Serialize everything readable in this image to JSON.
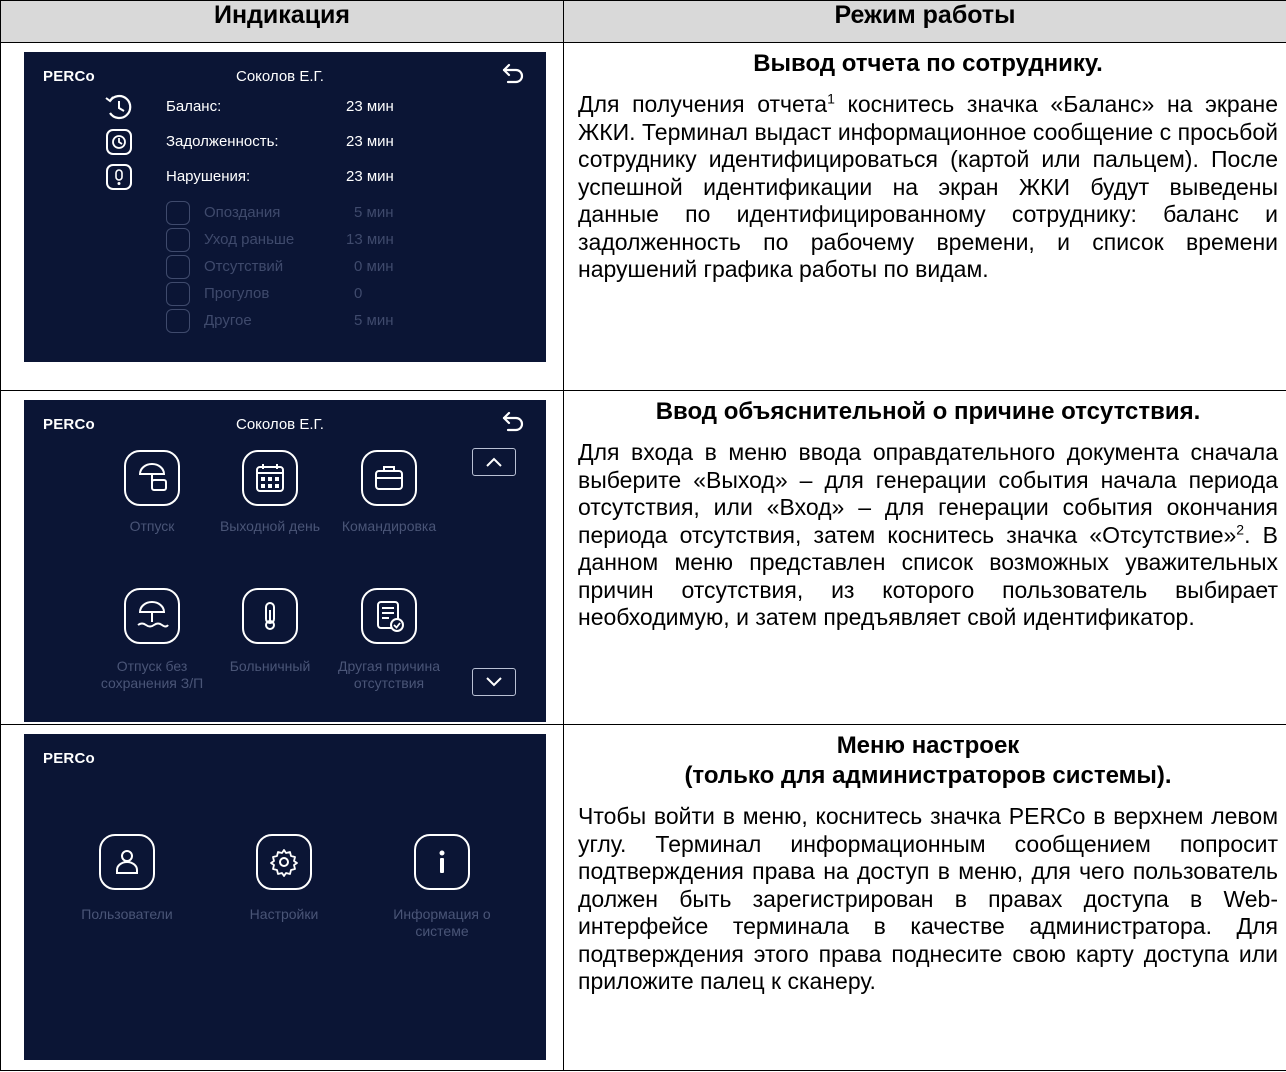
{
  "header": {
    "col1": "Индикация",
    "col2": "Режим работы"
  },
  "screen1": {
    "brand": "PERCo",
    "user": "Соколов Е.Г.",
    "main_rows": [
      {
        "label": "Баланс:",
        "value": "23 мин"
      },
      {
        "label": "Задолженность:",
        "value": "23 мин"
      },
      {
        "label": "Нарушения:",
        "value": "23 мин"
      }
    ],
    "sub_rows": [
      {
        "label": "Опоздания",
        "value": "5 мин"
      },
      {
        "label": "Уход раньше",
        "value": "13 мин"
      },
      {
        "label": "Отсутствий",
        "value": "0 мин"
      },
      {
        "label": "Прогулов",
        "value": "0"
      },
      {
        "label": "Другое",
        "value": "5 мин"
      }
    ]
  },
  "screen2": {
    "brand": "PERCo",
    "user": "Соколов Е.Г.",
    "tiles": [
      {
        "label": "Отпуск"
      },
      {
        "label": "Выходной день"
      },
      {
        "label": "Командировка"
      },
      {
        "label": "Отпуск без сохранения З/П"
      },
      {
        "label": "Больничный"
      },
      {
        "label": "Другая причина отсутствия"
      }
    ]
  },
  "screen3": {
    "brand": "PERCo",
    "tiles": [
      {
        "label": "Пользователи"
      },
      {
        "label": "Настройки"
      },
      {
        "label": "Информация о системе"
      }
    ]
  },
  "sections": [
    {
      "title": "Вывод отчета по сотруднику.",
      "body_pre": "Для получения отчета",
      "sup": "1",
      "body_post": " коснитесь значка «Баланс» на экране ЖКИ. Терминал выдаст информационное сообщение с просьбой сотруднику идентифицироваться (картой или пальцем). После успешной идентификации на экран ЖКИ будут выведены данные по идентифицированному сотруднику: баланс и задолженность по рабочему времени, и список времени нарушений графика работы по видам."
    },
    {
      "title": "Ввод объяснительной о причине отсутствия.",
      "body_pre": "Для входа в меню ввода оправдательного документа сначала выберите «Выход» – для генерации события начала периода отсутствия, или «Вход» – для генерации события окончания периода отсутствия, затем коснитесь значка «Отсутствие»",
      "sup": "2",
      "body_post": ". В данном меню представлен список возможных уважительных причин отсутствия, из которого пользователь выбирает необходимую, и затем предъявляет свой идентификатор."
    },
    {
      "title": "Меню настроек",
      "title2": "(только для администраторов системы).",
      "body": "Чтобы войти в меню, коснитесь значка PERCo в верхнем левом углу. Терминал информационным сообщением попросит подтверждения права на доступ в меню, для чего пользователь должен быть зарегистрирован в правах доступа в Web-интерфейсе терминала в качестве администратора. Для подтверждения этого права поднесите свою карту доступа или приложите палец к сканеру."
    }
  ]
}
